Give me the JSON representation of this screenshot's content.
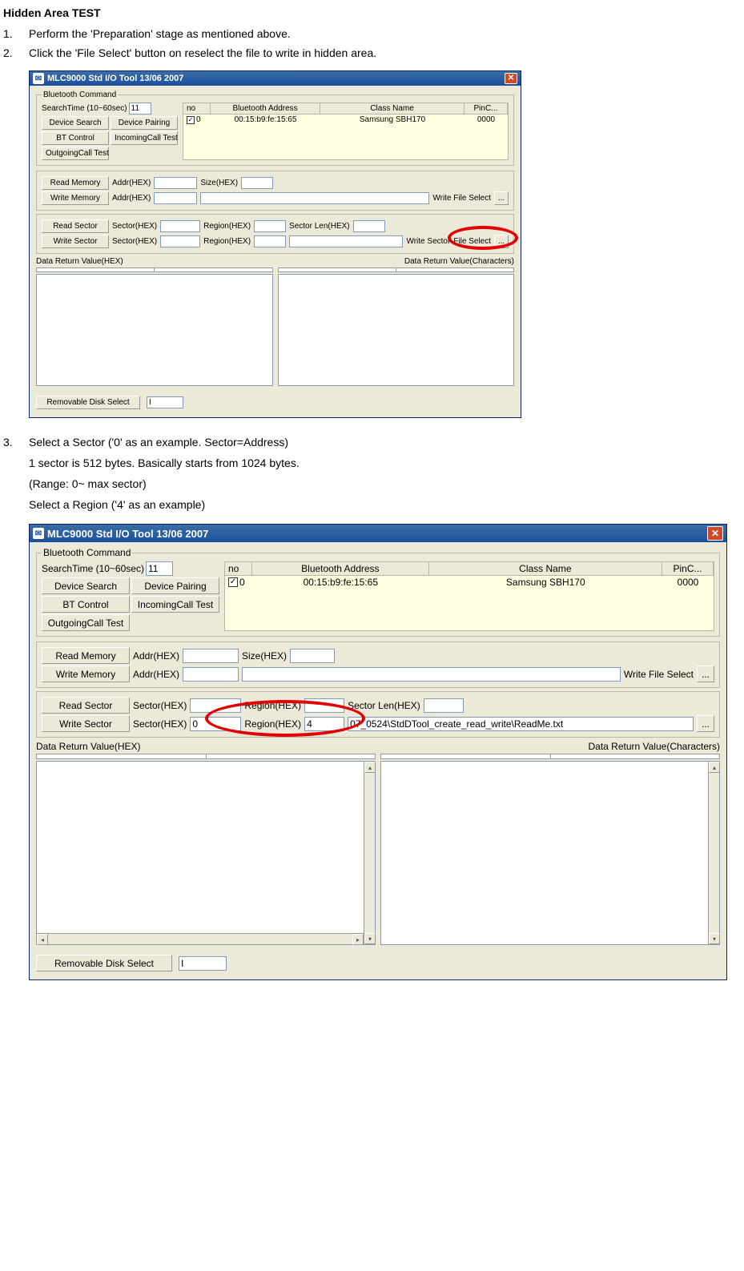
{
  "doc": {
    "heading": "Hidden Area TEST",
    "steps": {
      "s1": {
        "num": "1.",
        "text": "Perform the 'Preparation' stage as mentioned above."
      },
      "s2": {
        "num": "2.",
        "text": "Click the 'File Select' button on reselect the file to write in hidden area."
      },
      "s3": {
        "num": "3.",
        "line1": "Select a Sector ('0' as an example. Sector=Address)",
        "line2": "1 sector is 512 bytes. Basically starts from 1024 bytes.",
        "line3": "(Range: 0~ max sector)",
        "line4": "Select a Region ('4' as an example)"
      }
    }
  },
  "win1": {
    "title": "MLC9000 Std I/O Tool  13/06 2007",
    "bt": {
      "legend": "Bluetooth Command",
      "searchtime_label": "SearchTime (10~60sec)",
      "searchtime_value": "11",
      "device_search": "Device Search",
      "device_pairing": "Device Pairing",
      "bt_control": "BT Control",
      "incoming": "IncomingCall Test",
      "outgoing": "OutgoingCall Test"
    },
    "table": {
      "h_no": "no",
      "h_addr": "Bluetooth Address",
      "h_class": "Class Name",
      "h_pin": "PinC...",
      "row": {
        "no": "0",
        "addr": "00:15:b9:fe:15:65",
        "class": "Samsung SBH170",
        "pin": "0000"
      }
    },
    "mem": {
      "read_memory": "Read Memory",
      "write_memory": "Write Memory",
      "addr_label": "Addr(HEX)",
      "size_label": "Size(HEX)",
      "write_file_select": "Write File Select",
      "browse": "..."
    },
    "sec": {
      "read_sector": "Read Sector",
      "write_sector": "Write Sector",
      "sector_label": "Sector(HEX)",
      "region_label": "Region(HEX)",
      "seclen_label": "Sector Len(HEX)",
      "write_sector2": "Write Sector",
      "file_select": "File Select",
      "browse": "..."
    },
    "drv": {
      "left_label": "Data Return Value(HEX)",
      "right_label": "Data Return Value(Characters)"
    },
    "footer": {
      "removable": "Removable Disk Select",
      "value": "I"
    }
  },
  "win2": {
    "title": "MLC9000 Std I/O Tool  13/06 2007",
    "bt": {
      "legend": "Bluetooth Command",
      "searchtime_label": "SearchTime (10~60sec)",
      "searchtime_value": "11",
      "device_search": "Device Search",
      "device_pairing": "Device Pairing",
      "bt_control": "BT Control",
      "incoming": "IncomingCall Test",
      "outgoing": "OutgoingCall Test"
    },
    "table": {
      "h_no": "no",
      "h_addr": "Bluetooth Address",
      "h_class": "Class Name",
      "h_pin": "PinC...",
      "row": {
        "no": "0",
        "addr": "00:15:b9:fe:15:65",
        "class": "Samsung SBH170",
        "pin": "0000"
      }
    },
    "mem": {
      "read_memory": "Read Memory",
      "write_memory": "Write Memory",
      "addr_label": "Addr(HEX)",
      "size_label": "Size(HEX)",
      "write_file_select": "Write File Select",
      "browse": "..."
    },
    "sec": {
      "read_sector": "Read Sector",
      "write_sector": "Write Sector",
      "sector_label": "Sector(HEX)",
      "region_label": "Region(HEX)",
      "seclen_label": "Sector Len(HEX)",
      "sector_val": "0",
      "region_val": "4",
      "path": "07_0524\\StdDTool_create_read_write\\ReadMe.txt",
      "browse": "..."
    },
    "drv": {
      "left_label": "Data Return Value(HEX)",
      "right_label": "Data Return Value(Characters)"
    },
    "footer": {
      "removable": "Removable Disk Select",
      "value": "I"
    }
  }
}
